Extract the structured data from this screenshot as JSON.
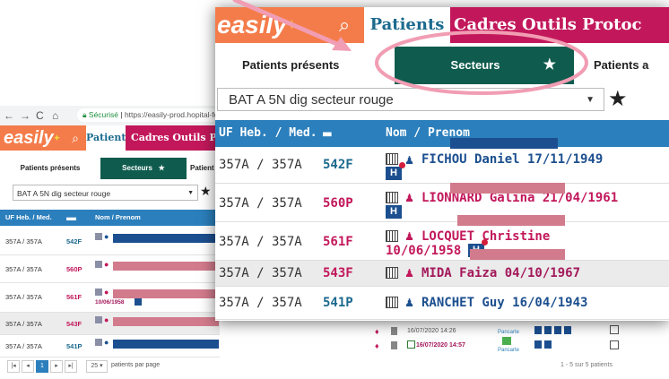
{
  "colors": {
    "brand_orange": "#f47c4a",
    "nav_red": "#c2185b",
    "secteur_green": "#0f5c4e",
    "header_blue": "#2b7fbc",
    "bed_blue": "#1c6a8e",
    "bed_pink": "#c2185b",
    "annotation_pink": "#f19db3",
    "redaction_blue": "#1c4f8f",
    "redaction_pink": "#d27b8c"
  },
  "browser": {
    "security_label": "Sécurisé",
    "url": "https://easily-prod.hopital-foch.n"
  },
  "app": {
    "logo": "easily",
    "search_icon": "search-icon",
    "nav": {
      "patients": "Patients",
      "cadres": "Cadres",
      "outils": "Outils",
      "protoc": "Protoc",
      "prot_small": "Prot"
    },
    "subnav": {
      "presents": "Patients présents",
      "secteurs": "Secteurs",
      "patients_a": "Patients a",
      "patient_small": "Patient"
    },
    "sector_select": "BAT A 5N dig secteur rouge",
    "favorite_icon": "star-icon"
  },
  "table": {
    "headers": {
      "uf": "UF Heb. / Med.",
      "bed": "bed-icon",
      "name": "Nom / Prenom"
    },
    "rows": [
      {
        "uf": "357A / 357A",
        "bed": "542F",
        "name": "FICHOU Daniel 17/11/1949",
        "sex": "male",
        "redaction": "blue"
      },
      {
        "uf": "357A / 357A",
        "bed": "560P",
        "name": "LIONNARD Galina 21/04/1961",
        "sex": "female",
        "redaction": "pink"
      },
      {
        "uf": "357A / 357A",
        "bed": "561F",
        "name": "LOCQUET Christine",
        "name2": "10/06/1958",
        "sex": "female",
        "redaction": "pink"
      },
      {
        "uf": "357A / 357A",
        "bed": "543F",
        "name": "MIDA Faiza 04/10/1967",
        "sex": "female",
        "redaction": "pink"
      },
      {
        "uf": "357A / 357A",
        "bed": "541P",
        "name": "RANCHET Guy 16/04/1943",
        "sex": "male",
        "redaction": "blue"
      }
    ]
  },
  "back_extra": {
    "row4_date": "16/07/2020 14:26",
    "row5_date": "16/07/2020 14:57",
    "pancarte": "Pancarte"
  },
  "pagination": {
    "current": "1",
    "page_size": "25",
    "per_page_label": "patients par page",
    "summary": "1 - 5 sur 5 patients"
  }
}
